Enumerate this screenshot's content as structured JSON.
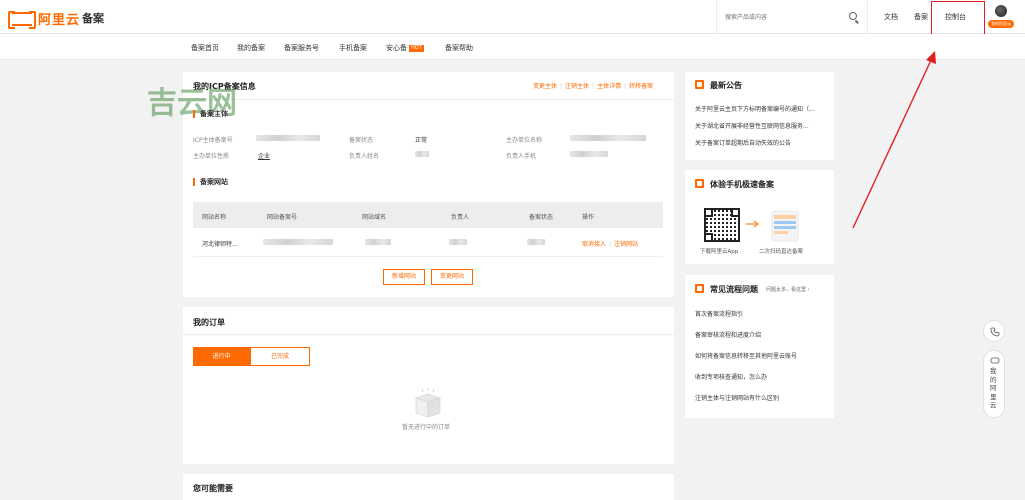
{
  "header": {
    "logo_text": "阿里云",
    "product": "备案",
    "search_placeholder": "搜索产品或内容",
    "links": [
      "文档",
      "备案",
      "控制台"
    ],
    "avatar_badge": "我的阿里云"
  },
  "subnav": {
    "items": [
      "备案首页",
      "我的备案",
      "备案服务号",
      "手机备案",
      "安心备",
      "备案帮助"
    ],
    "hot_badge": "HOT"
  },
  "watermark": "吉云网",
  "icp_card": {
    "title": "我的ICP备案信息",
    "actions": [
      "变更主体",
      "注销主体",
      "主体详情",
      "转移备案"
    ],
    "subject_section": "备案主体",
    "fields": {
      "icp_no_label": "ICP主体备案号",
      "status_label": "备案状态",
      "status_value": "正常",
      "org_name_label": "主办单位名称",
      "org_type_label": "主办单位性质",
      "org_type_value": "企业",
      "owner_label": "负责人姓名",
      "owner_phone_label": "负责人手机"
    },
    "site_section": "备案网站",
    "table_headers": [
      "网站名称",
      "网站备案号",
      "网站域名",
      "负责人",
      "备案状态",
      "操作"
    ],
    "row": {
      "site_name": "河北律师特...",
      "ops": [
        "取消接入",
        "注销网站"
      ]
    },
    "buttons": [
      "新增网站",
      "变更网站"
    ]
  },
  "orders_card": {
    "title": "我的订单",
    "tabs": [
      "进行中",
      "已完成"
    ],
    "empty_text": "暂无进行中的订单"
  },
  "maybe_card": {
    "title": "您可能需要"
  },
  "notice_card": {
    "title": "最新公告",
    "items": [
      "关于阿里云主页下方标明备案编号的通知（...",
      "关于湖北省开展非经营性互联网信息服务...",
      "关于备案订单超期后自动失效的公告"
    ]
  },
  "mobile_card": {
    "title": "体验手机极速备案",
    "qr_caption": "下载阿里云App",
    "scan_caption": "二次扫码直达备案"
  },
  "faq_card": {
    "title": "常见流程问题",
    "more": "问题太多，看这里",
    "items": [
      "首次备案流程指引",
      "备案审核流程和进度介绍",
      "如何将备案信息转移至其他阿里云账号",
      "收到专项核查通知，怎么办",
      "注销主体与注销网站有什么区别"
    ]
  },
  "float": {
    "contact_text": "我的阿里云"
  },
  "colors": {
    "accent": "#ff6a00",
    "highlight": "#e02020"
  }
}
